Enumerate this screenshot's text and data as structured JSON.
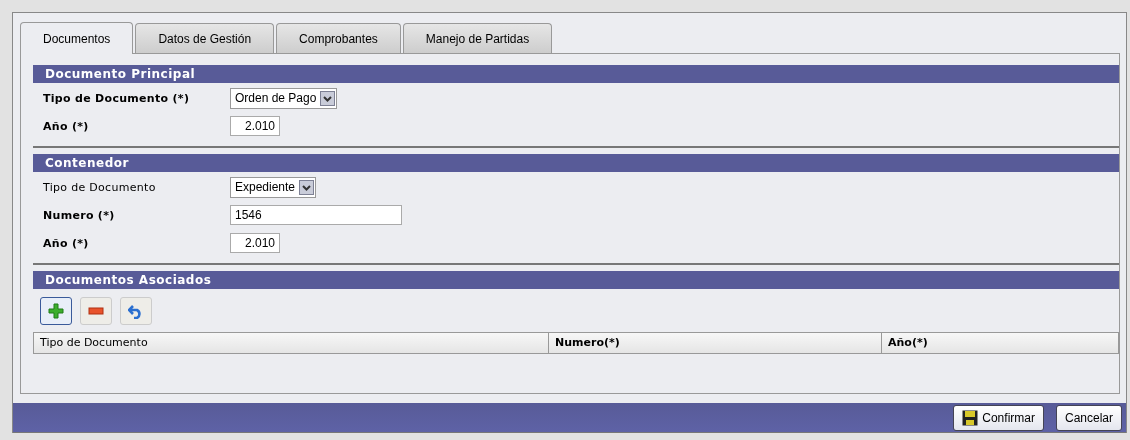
{
  "tabs": [
    {
      "label": "Documentos",
      "selected": true
    },
    {
      "label": "Datos de Gestión",
      "selected": false
    },
    {
      "label": "Comprobantes",
      "selected": false
    },
    {
      "label": "Manejo de Partidas",
      "selected": false
    }
  ],
  "sections": [
    {
      "kind": "form",
      "title": "Documento Principal",
      "fields": [
        {
          "label": "Tipo de Documento (*)",
          "bold": true,
          "kind": "select",
          "value": "Orden de Pago"
        },
        {
          "label": "Año (*)",
          "bold": true,
          "kind": "year",
          "value": "2.010"
        }
      ]
    },
    {
      "kind": "form",
      "title": "Contenedor",
      "fields": [
        {
          "label": "Tipo de Documento",
          "bold": false,
          "kind": "select",
          "value": "Expediente"
        },
        {
          "label": "Numero (*)",
          "bold": true,
          "kind": "text",
          "value": "1546"
        },
        {
          "label": "Año (*)",
          "bold": true,
          "kind": "year",
          "value": "2.010"
        }
      ]
    },
    {
      "kind": "grid",
      "title": "Documentos Asociados",
      "tools": [
        {
          "kind": "add",
          "focused": true
        },
        {
          "kind": "remove",
          "focused": false
        },
        {
          "kind": "undo",
          "focused": false
        }
      ],
      "columns": [
        {
          "label": "Tipo de Documento",
          "bold": false
        },
        {
          "label": "Numero(*)",
          "bold": true
        },
        {
          "label": "Año(*)",
          "bold": true
        }
      ]
    }
  ],
  "buttons": [
    {
      "label": "Confirmar",
      "kind": "save"
    },
    {
      "label": "Cancelar",
      "kind": "plain"
    }
  ]
}
